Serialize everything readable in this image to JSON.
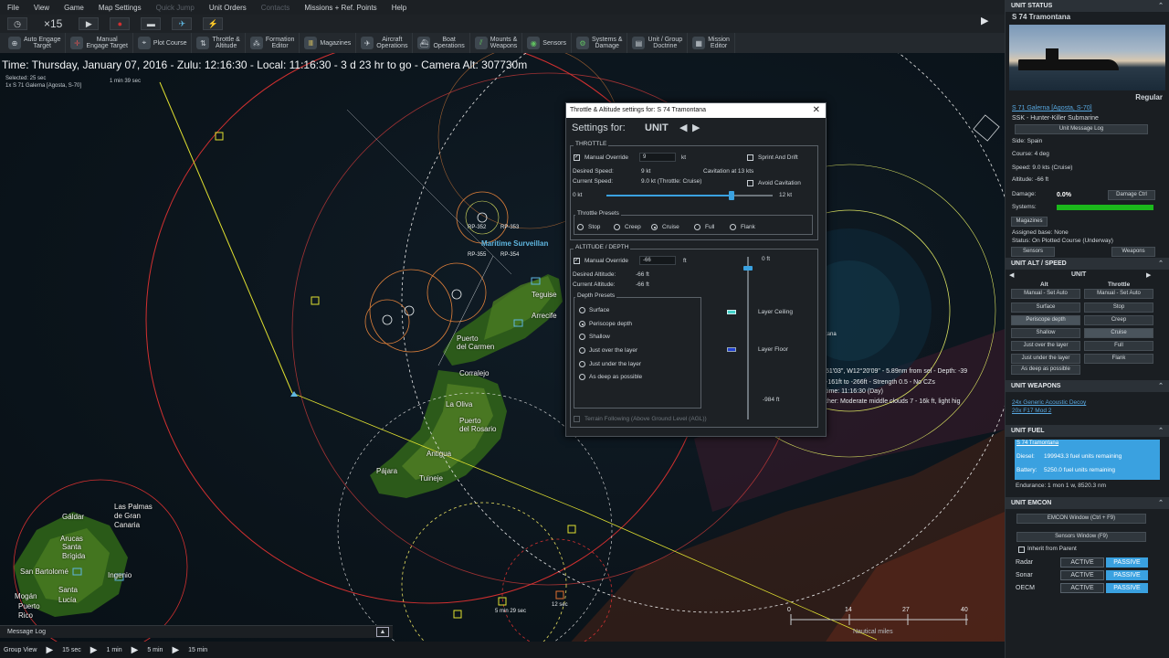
{
  "menu": [
    "File",
    "View",
    "Game",
    "Map Settings",
    "Quick Jump",
    "Unit Orders",
    "Contacts",
    "Missions + Ref. Points",
    "Help"
  ],
  "menu_dim": [
    "Quick Jump",
    "Contacts"
  ],
  "controls": {
    "speed": "×15"
  },
  "toolbar": [
    {
      "label": "Auto Engage\nTarget"
    },
    {
      "label": "Manual\nEngage Target"
    },
    {
      "label": "Plot Course"
    },
    {
      "label": "Throttle &\nAltitude"
    },
    {
      "label": "Formation\nEditor"
    },
    {
      "label": "Magazines"
    },
    {
      "label": "Aircraft\nOperations"
    },
    {
      "label": "Boat\nOperations"
    },
    {
      "label": "Mounts &\nWeapons"
    },
    {
      "label": "Sensors"
    },
    {
      "label": "Systems &\nDamage"
    },
    {
      "label": "Unit / Group\nDoctrine"
    },
    {
      "label": "Mission\nEditor"
    }
  ],
  "status_line": "Time: Thursday, January 07, 2016 - Zulu: 12:16:30 - Local: 11:16:30 - 3 d 23 hr to go -  Camera Alt: 307730m",
  "selection": {
    "line1": "Selected: 25 sec",
    "line2": "1x S 71 Galerna [Agosta, S-70]",
    "eta": "1 min 39 sec"
  },
  "map_labels": {
    "teguise": "Teguise",
    "arrecife": "Arrecife",
    "puerto_carmen": "Puerto\ndel Carmen",
    "corralejo": "Corralejo",
    "la_oliva": "La Oliva",
    "puerto_rosario": "Puerto\ndel Rosario",
    "antigua": "Antigua",
    "pajara": "Pájara",
    "tuineje": "Tuineje",
    "las_palmas": "Las Palmas\nde Gran\nCanaria",
    "galdar": "Gáldar",
    "arucas": "Arucas",
    "santa_brigida": "Santa\nBrígida",
    "san_bartolome": "San Bartolomé",
    "ingenio": "Ingenio",
    "santa_lucia": "Santa\nLucía",
    "mogan": "Mogán",
    "puerto_rico": "Puerto\nRico",
    "maritime": "Maritime Surveillan",
    "rp353": "RP-353",
    "rp352": "RP-352",
    "rp355": "RP-355",
    "rp354": "RP-354",
    "timer1": "12 sec",
    "timer2": "5 min 29 sec",
    "scale_0": "0",
    "scale_14": "14",
    "scale_27": "27",
    "scale_40": "40",
    "scale_unit": "Nautical miles",
    "info1": "51'03\", W12°20'09\" - 5.89nm from sel - Depth: -39",
    "info2": "-161ft to -266ft - Strength 0.5 - No CZs",
    "info3": "time: 11:16:30 (Day)",
    "info4": "ther: Moderate middle clouds 7 - 16k ft, light hig",
    "tana": "tana"
  },
  "message_log": "Message Log",
  "timesteps": [
    "Group View",
    "15 sec",
    "1 min",
    "5 min",
    "15 min"
  ],
  "dialog": {
    "title": "Throttle & Altitude settings for: S 74 Tramontana",
    "settings_for": "Settings for:",
    "unit": "UNIT",
    "throttle_group": "THROTTLE",
    "manual_override": "Manual Override",
    "speed_value": "9",
    "kt": "kt",
    "sprint": "Sprint And Drift",
    "desired_speed_lbl": "Desired Speed:",
    "desired_speed": "9 kt",
    "cavitation": "Cavitation at 13 kts",
    "current_speed_lbl": "Current Speed:",
    "current_speed": "9.0 kt (Throttle: Cruise)",
    "avoid_cav": "Avoid Cavitation",
    "slider_min": "0 kt",
    "slider_max": "12 kt",
    "throttle_fraction": 0.75,
    "presets_lbl": "Throttle Presets",
    "presets": [
      "Stop",
      "Creep",
      "Cruise",
      "Full",
      "Flank"
    ],
    "preset_selected": 2,
    "alt_group": "ALTITUDE / DEPTH",
    "alt_override": "Manual Override",
    "alt_value": "-66",
    "ft": "ft",
    "desired_alt_lbl": "Desired Altitude:",
    "desired_alt": "-66 ft",
    "current_alt_lbl": "Current Altitude:",
    "current_alt": "-66 ft",
    "depth_presets_lbl": "Depth Presets",
    "depth_presets": [
      "Surface",
      "Periscope depth",
      "Shallow",
      "Just over the layer",
      "Just under the layer",
      "As deep as possible"
    ],
    "depth_selected": 1,
    "zero_ft": "0 ft",
    "layer_ceiling": "Layer Ceiling",
    "layer_floor": "Layer Floor",
    "max_depth": "-984 ft",
    "terrain": "Terrain Following (Above Ground Level (AGL))"
  },
  "panel": {
    "unit_status": "UNIT STATUS",
    "unit_name": "S 74 Tramontana",
    "regular": "Regular",
    "class_link": "S 71 Galerna [Agosta, S-70]",
    "type": "SSK - Hunter-Killer Submarine",
    "msg_log_btn": "Unit Message Log",
    "side": "Side: Spain",
    "course": "Course: 4 deg",
    "speed": "Speed: 9.0 kts (Cruise)",
    "altitude": "Altitude: -66 ft",
    "damage_lbl": "Damage:",
    "damage_val": "0.0%",
    "damage_btn": "Damage Ctrl",
    "systems": "Systems:",
    "magazines": "Magazines",
    "assigned": "Assigned base: None",
    "status": "Status: On Plotted Course (Underway)",
    "sensors_btn": "Sensors",
    "weapons_btn": "Weapons",
    "alt_speed": "UNIT ALT / SPEED",
    "unit": "UNIT",
    "alt": "Alt",
    "throttle": "Throttle",
    "manual_auto": "Manual - Set Auto",
    "left_btns": [
      "Surface",
      "Periscope depth",
      "Shallow",
      "Just over the layer",
      "Just under the layer",
      "As deep as possible"
    ],
    "right_btns": [
      "Stop",
      "Creep",
      "Cruise",
      "Full",
      "Flank"
    ],
    "weapons_sect": "UNIT WEAPONS",
    "weapon1": "24x Generic Acoustic Decoy",
    "weapon2": "20x F17 Mod 2",
    "fuel_sect": "UNIT FUEL",
    "fuel_unit": "S 74 Tramontana",
    "diesel_lbl": "Diesel:",
    "diesel": "199943.3 fuel units remaining",
    "battery_lbl": "Battery:",
    "battery": "5250.0 fuel units remaining",
    "endurance": "Endurance: 1 mon 1 w, 8520.3 nm",
    "emcon_sect": "UNIT EMCON",
    "emcon_btn": "EMCON Window (Ctrl + F9)",
    "sensors_window": "Sensors Window (F9)",
    "inherit": "Inherit from Parent",
    "radar": "Radar",
    "sonar": "Sonar",
    "oecm": "OECM",
    "active": "ACTIVE",
    "passive": "PASSIVE"
  },
  "colors": {
    "accent_blue": "#3aa1e0",
    "systems_green": "#1bb81b",
    "damage_green": "#48d848"
  }
}
